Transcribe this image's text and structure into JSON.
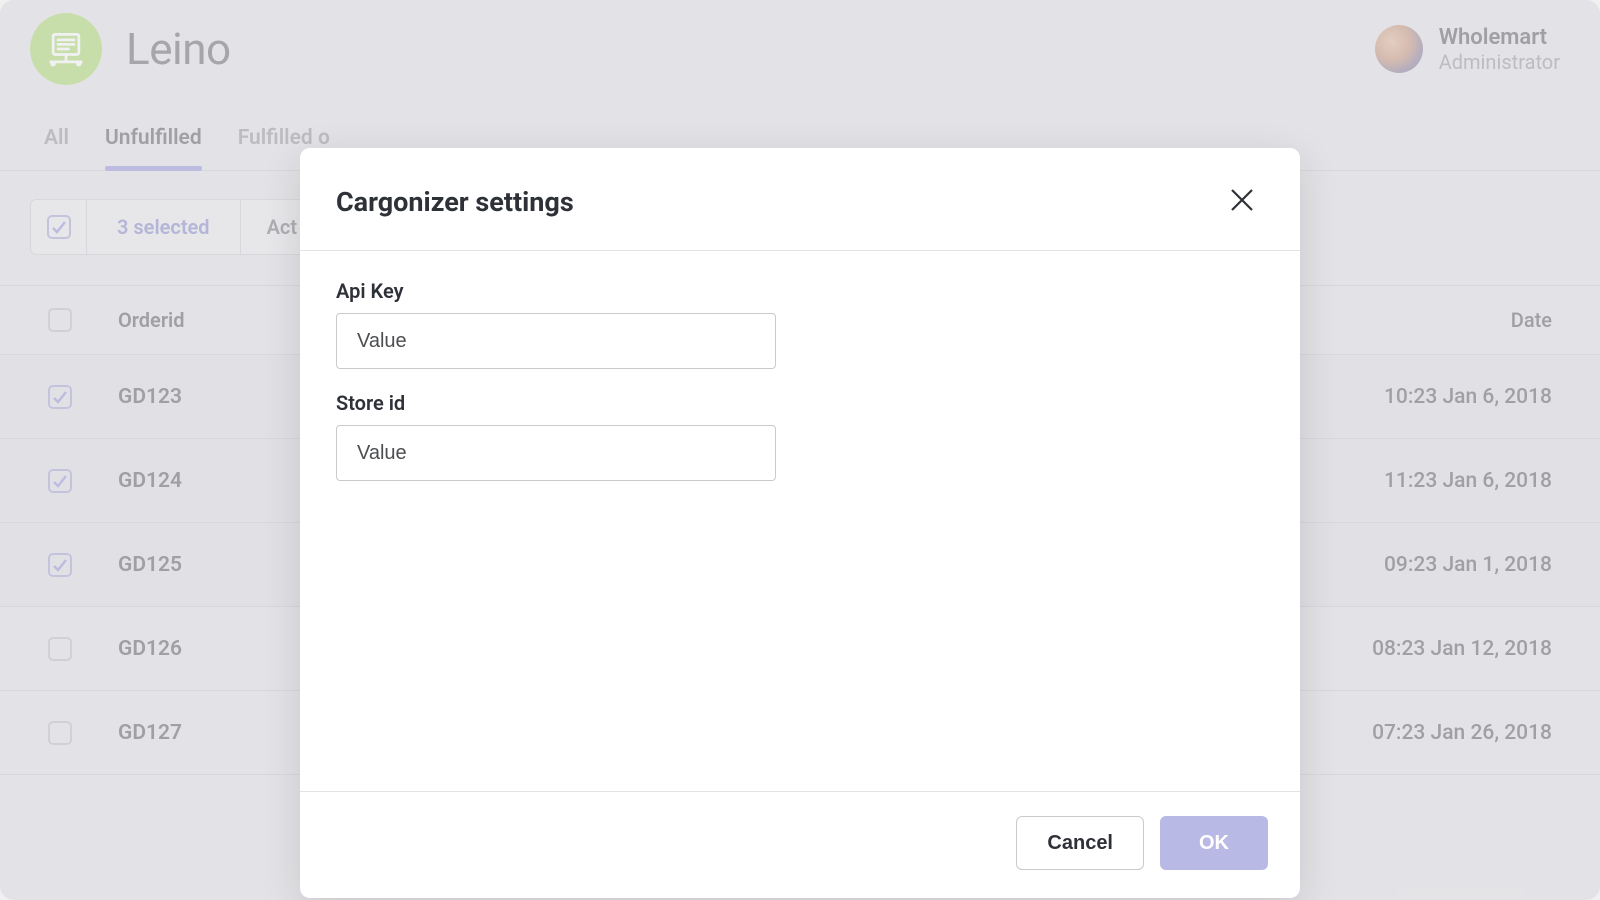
{
  "brand": {
    "name": "Leino"
  },
  "user": {
    "name": "Wholemart",
    "role": "Administrator"
  },
  "tabs": {
    "all": "All",
    "unfulfilled": "Unfulfilled",
    "fulfilled": "Fulfilled o"
  },
  "toolbar": {
    "selected_label": "3 selected",
    "actions_label": "Act"
  },
  "table": {
    "headers": {
      "orderid": "Orderid",
      "date": "Date"
    },
    "rows": [
      {
        "id": "GD123",
        "date": "10:23 Jan 6, 2018",
        "checked": true
      },
      {
        "id": "GD124",
        "date": "11:23 Jan 6, 2018",
        "checked": true
      },
      {
        "id": "GD125",
        "date": "09:23 Jan 1, 2018",
        "checked": true
      },
      {
        "id": "GD126",
        "date": "08:23 Jan 12, 2018",
        "checked": false
      },
      {
        "id": "GD127",
        "date": "07:23 Jan 26, 2018",
        "checked": false
      }
    ]
  },
  "modal": {
    "title": "Cargonizer settings",
    "fields": {
      "api_key": {
        "label": "Api Key",
        "placeholder": "Value",
        "value": ""
      },
      "store_id": {
        "label": "Store id",
        "placeholder": "Value",
        "value": ""
      }
    },
    "buttons": {
      "cancel": "Cancel",
      "ok": "OK"
    }
  }
}
